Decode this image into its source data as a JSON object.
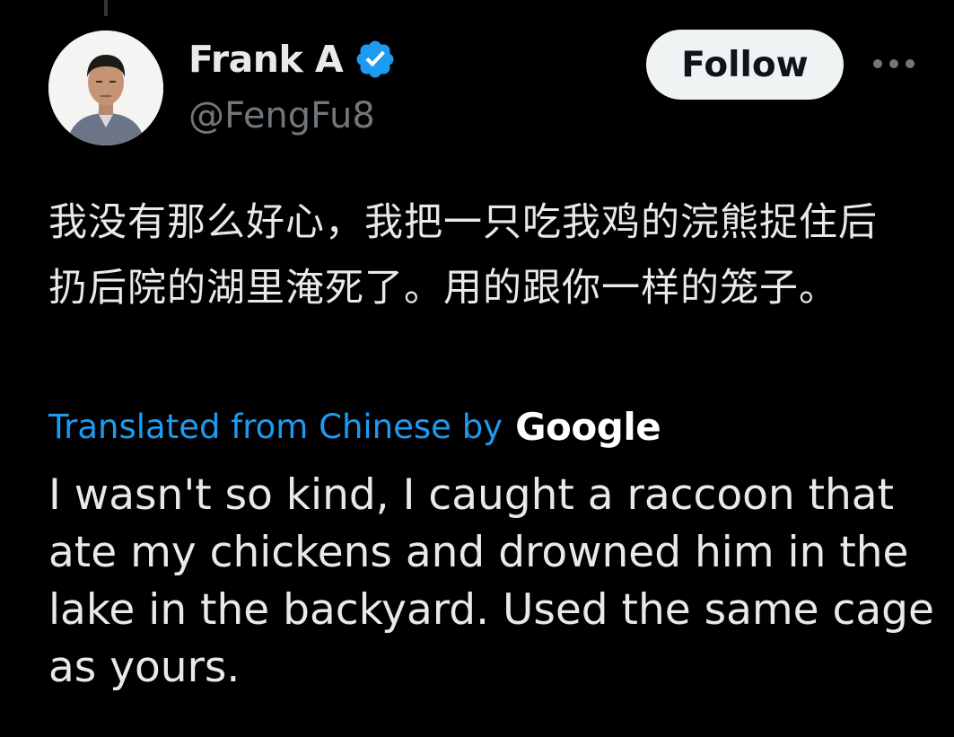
{
  "tweet": {
    "author": {
      "display_name": "Frank A",
      "handle": "@FengFu8",
      "verified": true,
      "verified_color": "#1d9bf0",
      "avatar_icon": "avatar-photo"
    },
    "follow_label": "Follow",
    "more_icon": "more-icon",
    "original_text": "我没有那么好心，我把一只吃我鸡的浣熊捉住后扔后院的湖里淹死了。用的跟你一样的笼子。",
    "translation": {
      "label": "Translated from Chinese by",
      "provider": "Google",
      "text": "I wasn't so kind, I caught a raccoon that ate my chickens and drowned him in the lake in the backyard. Used the same cage as yours."
    }
  },
  "colors": {
    "background": "#000000",
    "text_primary": "#e7e9ea",
    "text_secondary": "#71767b",
    "link": "#1d9bf0",
    "follow_bg": "#eff3f4",
    "follow_text": "#0f1419"
  }
}
